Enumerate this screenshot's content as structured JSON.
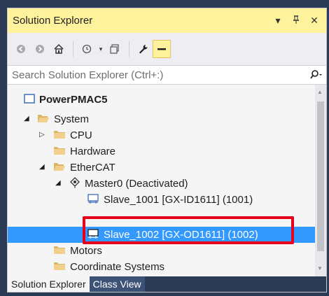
{
  "panel": {
    "title": "Solution Explorer",
    "controls": [
      "▾",
      "⊓",
      "✕"
    ]
  },
  "toolbar": {
    "icons": [
      "back-icon",
      "forward-icon",
      "home-icon",
      "history-icon",
      "pending-changes-icon",
      "properties-wrench-icon",
      "collapse-all-icon"
    ]
  },
  "search": {
    "placeholder": "Search Solution Explorer (Ctrl+:)"
  },
  "tree": {
    "root": "PowerPMAC5",
    "system": "System",
    "cpu": "CPU",
    "hardware": "Hardware",
    "ethercat": "EtherCAT",
    "master": "Master0 (Deactivated)",
    "slave1": "Slave_1001 [GX-ID1611] (1001)",
    "slave2": "Slave_1002 [GX-OD1611] (1002)",
    "motors": "Motors",
    "coord": "Coordinate Systems"
  },
  "tabs": [
    "Solution Explorer",
    "Class View"
  ],
  "colors": {
    "title_bar": "#fff29d",
    "selection": "#3399ff",
    "highlight_box": "#e8001a",
    "folder": "#dcb567"
  }
}
